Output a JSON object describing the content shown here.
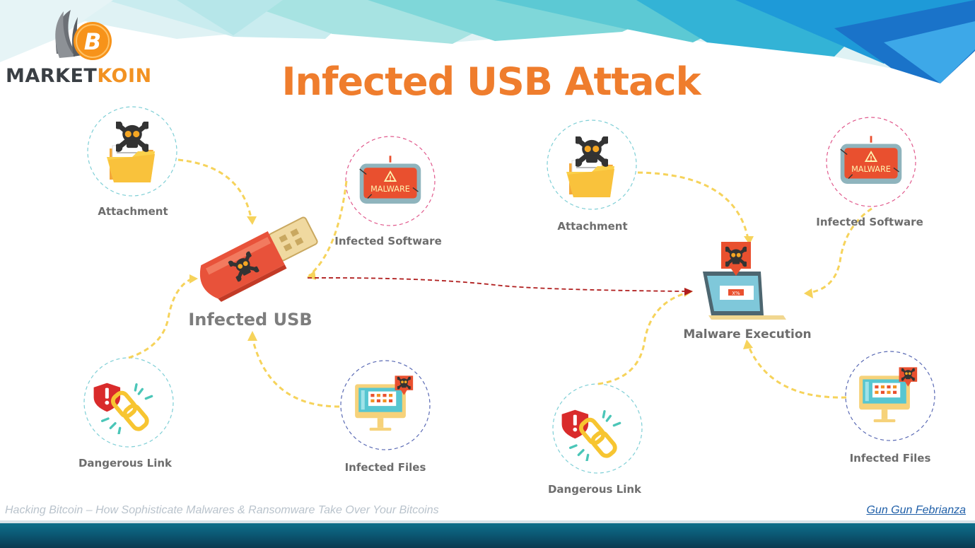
{
  "logo": {
    "word_market": "MARKET",
    "word_koin": "KOIN",
    "coin_glyph": "B"
  },
  "title": "Infected USB Attack",
  "left_diagram": {
    "center_label": "Infected USB",
    "attachment_label": "Attachment",
    "software_label": "Infected Software",
    "link_label": "Dangerous Link",
    "files_label": "Infected Files"
  },
  "right_diagram": {
    "center_label": "Malware Execution",
    "attachment_label": "Attachment",
    "software_label": "Infected Software",
    "link_label": "Dangerous Link",
    "files_label": "Infected Files"
  },
  "icon_texts": {
    "malware": "MALWARE",
    "screen_badge": "X%"
  },
  "footer": {
    "left": "Hacking Bitcoin – How Sophisticate Malwares & Ransomware Take Over Your Bitcoins",
    "right": "Gun Gun Febrianza"
  },
  "colors": {
    "title": "#ef7d2d",
    "label_gray": "#6d6d6d",
    "flow_arrow": "#f6d35b",
    "main_arrow": "#b01e1e",
    "usb_red": "#e8523a",
    "folder_yellow": "#f9c23c",
    "malware_red": "#e9502f",
    "footer_blue": "#1f5fa8"
  },
  "icons": [
    "bitcoin-wing-logo",
    "skull-folder-icon",
    "malware-screen-icon",
    "usb-drive-icon",
    "broken-link-shield-icon",
    "infected-monitor-icon",
    "laptop-skull-icon"
  ]
}
